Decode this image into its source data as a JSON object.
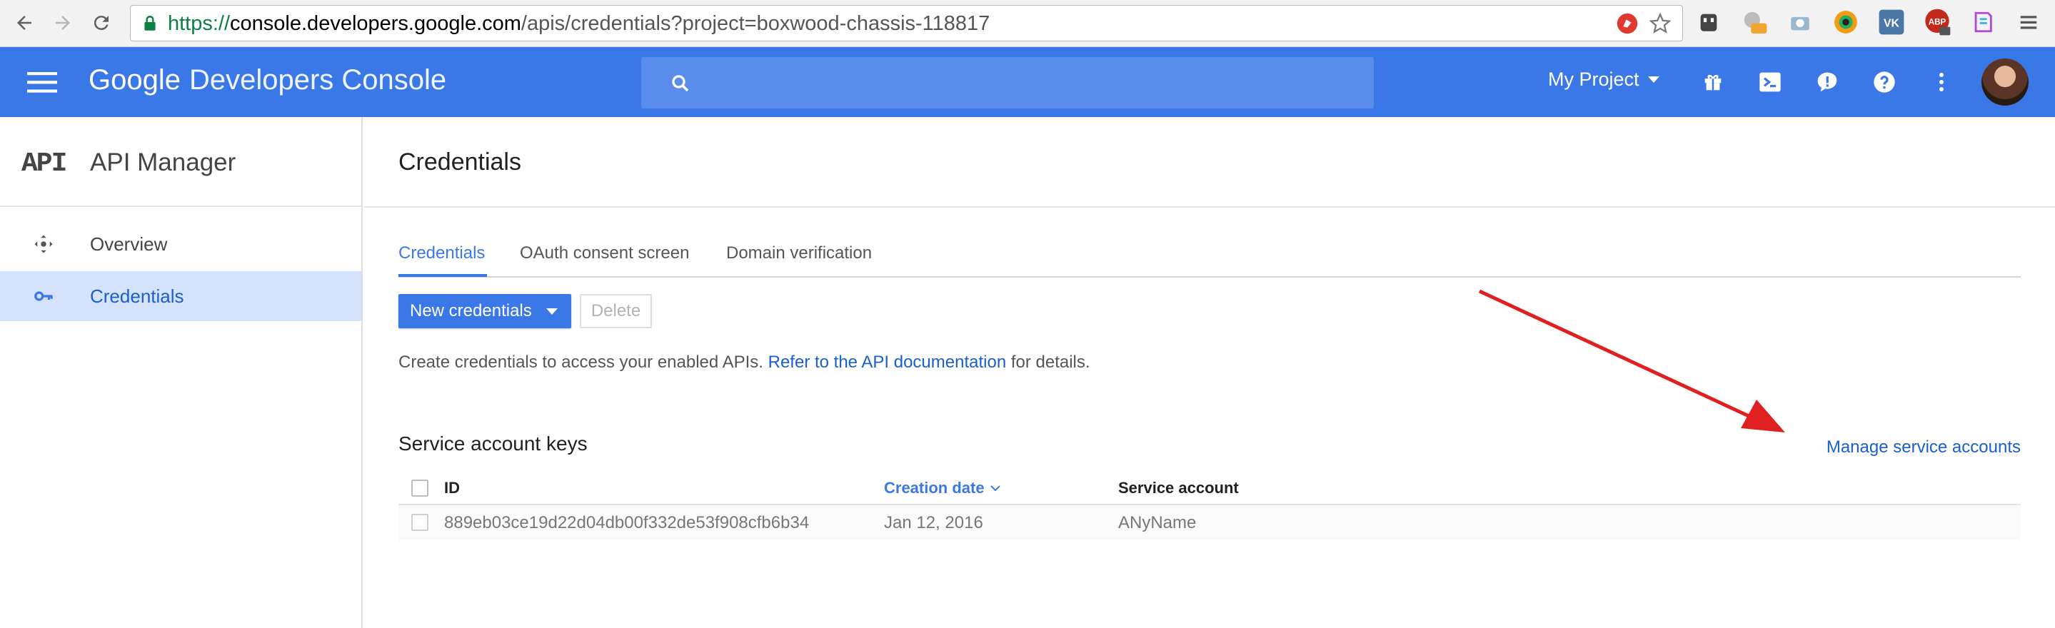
{
  "browser": {
    "url_scheme": "https://",
    "url_host": "console.developers.google.com",
    "url_path": "/apis/credentials?project=boxwood-chassis-118817",
    "extension_icons": [
      "adblock-icon",
      "star-icon",
      "robot-extension-icon",
      "off-extension-icon",
      "camera-icon",
      "eye-extension-icon",
      "vk-icon",
      "abp-icon",
      "bookmark-icon",
      "chrome-menu-icon"
    ]
  },
  "header": {
    "brand_google": "Google",
    "brand_product": "Developers Console",
    "search_placeholder": "",
    "project": "My Project",
    "accent_color": "#3b78e7"
  },
  "sidebar": {
    "logo": "API",
    "title": "API Manager",
    "items": [
      {
        "label": "Overview",
        "icon": "overview-icon",
        "active": false
      },
      {
        "label": "Credentials",
        "icon": "key-icon",
        "active": true
      }
    ]
  },
  "main": {
    "title": "Credentials",
    "tabs": [
      {
        "label": "Credentials",
        "active": true
      },
      {
        "label": "OAuth consent screen",
        "active": false
      },
      {
        "label": "Domain verification",
        "active": false
      }
    ],
    "new_credentials_label": "New credentials",
    "delete_label": "Delete",
    "help_prefix": "Create credentials to access your enabled APIs. ",
    "help_link": "Refer to the API documentation",
    "help_suffix": " for details.",
    "section_title": "Service account keys",
    "manage_link": "Manage service accounts",
    "table": {
      "columns": [
        "ID",
        "Creation date",
        "Service account"
      ],
      "rows": [
        {
          "id": "889eb03ce19d22d04db00f332de53f908cfb6b34",
          "date": "Jan 12, 2016",
          "account": "ANyName"
        }
      ]
    }
  }
}
